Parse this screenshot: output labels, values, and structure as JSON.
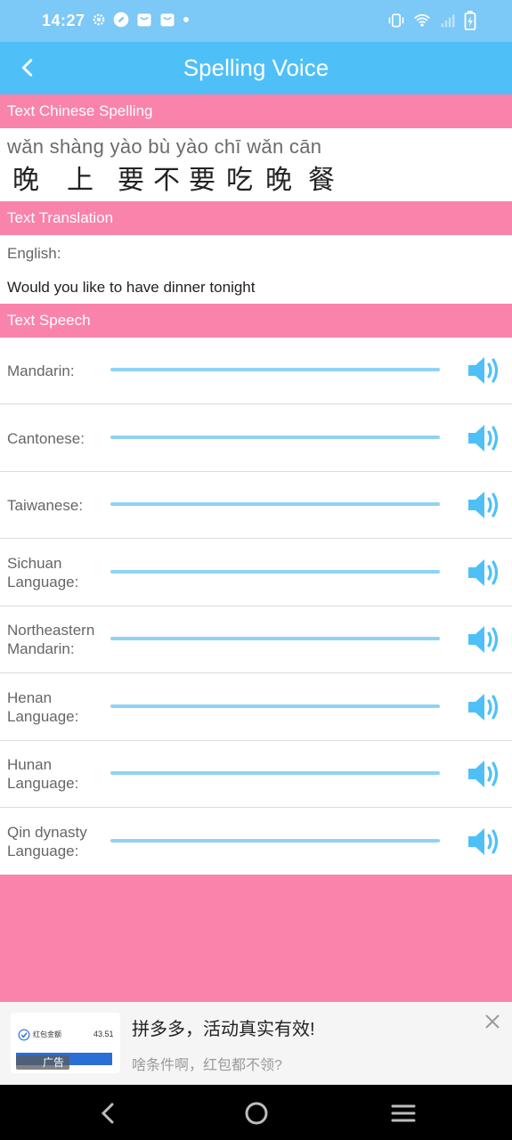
{
  "status": {
    "time": "14:27"
  },
  "app": {
    "title": "Spelling Voice"
  },
  "sections": {
    "spelling": "Text Chinese Spelling",
    "translation": "Text Translation",
    "speech": "Text Speech"
  },
  "spelling": {
    "pinyin": "wǎn shàng yào bù yào chī wǎn cān",
    "characters": [
      "晚",
      "上",
      "要",
      "不",
      "要",
      "吃",
      "晚",
      "餐"
    ]
  },
  "translation": {
    "language_label": "English:",
    "text": "Would you like to have dinner tonight"
  },
  "speech_rows": [
    {
      "label": "Mandarin:",
      "progress": 0
    },
    {
      "label": "Cantonese:",
      "progress": 0
    },
    {
      "label": "Taiwanese:",
      "progress": 0
    },
    {
      "label": "Sichuan Language:",
      "progress": 0
    },
    {
      "label": "Northeastern Mandarin:",
      "progress": 0
    },
    {
      "label": "Henan Language:",
      "progress": 0
    },
    {
      "label": "Hunan Language:",
      "progress": 0
    },
    {
      "label": "Qin dynasty Language:",
      "progress": 0
    }
  ],
  "ad": {
    "title": "拼多多，活动真实有效!",
    "subtitle": "啥条件啊，红包都不领?",
    "badge": "广告",
    "thumb_text": "红包金额",
    "thumb_number": "43.51"
  },
  "colors": {
    "status_bar": "#7cc8f6",
    "app_bar": "#4fc0f7",
    "section_pink": "#f983aa",
    "speaker_blue": "#4fc0f7",
    "bar_blue": "#8fd3f4"
  },
  "icons": {
    "back": "back-arrow-icon",
    "speaker": "speaker-icon",
    "close": "close-icon",
    "nav_back": "nav-back-icon",
    "nav_home": "nav-home-icon",
    "nav_menu": "nav-menu-icon"
  }
}
